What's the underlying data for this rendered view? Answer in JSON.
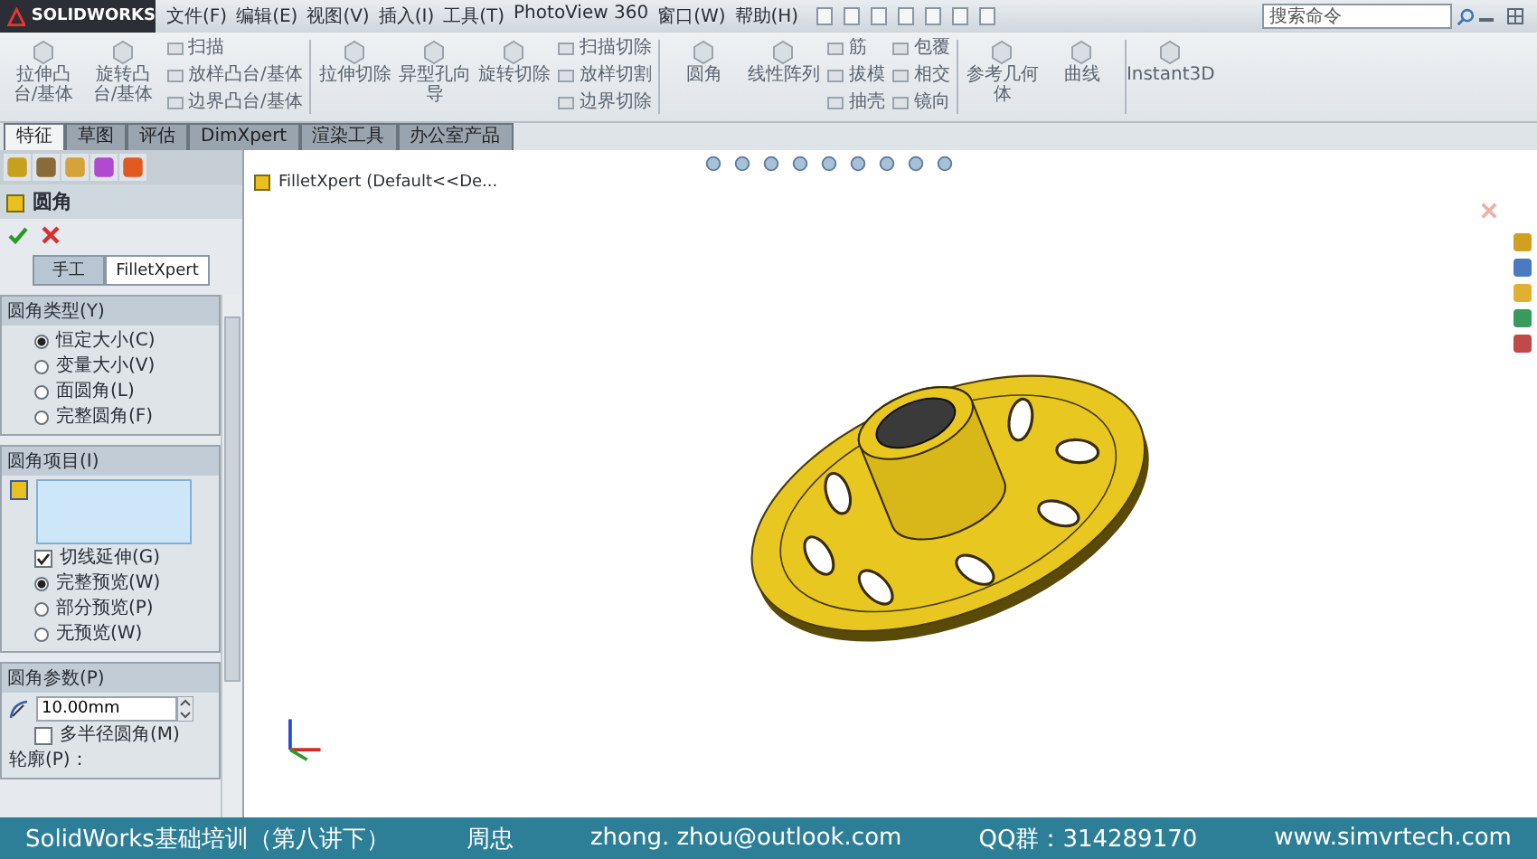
{
  "app": {
    "logo": "SOLIDWORKS"
  },
  "menu": [
    "文件(F)",
    "编辑(E)",
    "视图(V)",
    "插入(I)",
    "工具(T)",
    "PhotoView 360",
    "窗口(W)",
    "帮助(H)"
  ],
  "search": {
    "placeholder": "搜索命令"
  },
  "ribbon": [
    {
      "items": [
        {
          "kind": "large",
          "label": "拉伸凸台/基体"
        },
        {
          "kind": "large",
          "label": "旋转凸台/基体"
        },
        {
          "kind": "stack",
          "labels": [
            "扫描",
            "放样凸台/基体",
            "边界凸台/基体"
          ]
        }
      ]
    },
    {
      "items": [
        {
          "kind": "large",
          "label": "拉伸切除"
        },
        {
          "kind": "large",
          "label": "异型孔向导"
        },
        {
          "kind": "large",
          "label": "旋转切除"
        },
        {
          "kind": "stack",
          "labels": [
            "扫描切除",
            "放样切割",
            "边界切除"
          ]
        }
      ]
    },
    {
      "items": [
        {
          "kind": "large",
          "label": "圆角"
        },
        {
          "kind": "large",
          "label": "线性阵列"
        },
        {
          "kind": "stack",
          "labels": [
            "筋",
            "拔模",
            "抽壳"
          ]
        },
        {
          "kind": "stack",
          "labels": [
            "包覆",
            "相交",
            "镜向"
          ]
        }
      ]
    },
    {
      "items": [
        {
          "kind": "large",
          "label": "参考几何体"
        },
        {
          "kind": "large",
          "label": "曲线"
        }
      ]
    },
    {
      "items": [
        {
          "kind": "large",
          "label": "Instant3D"
        }
      ]
    }
  ],
  "tabs": [
    {
      "label": "特征",
      "selected": true
    },
    {
      "label": "草图",
      "selected": false
    },
    {
      "label": "评估",
      "selected": false
    },
    {
      "label": "DimXpert",
      "selected": false
    },
    {
      "label": "渲染工具",
      "selected": false
    },
    {
      "label": "办公室产品",
      "selected": false
    }
  ],
  "panel": {
    "title": "圆角",
    "modes": [
      {
        "label": "手工",
        "selected": true
      },
      {
        "label": "FilletXpert",
        "selected": false
      }
    ],
    "groups": [
      {
        "title": "圆角类型(Y)",
        "rows": [
          {
            "kind": "radio",
            "label": "恒定大小(C)",
            "selected": true
          },
          {
            "kind": "radio",
            "label": "变量大小(V)",
            "selected": false
          },
          {
            "kind": "radio",
            "label": "面圆角(L)",
            "selected": false
          },
          {
            "kind": "radio",
            "label": "完整圆角(F)",
            "selected": false
          }
        ]
      },
      {
        "title": "圆角项目(I)",
        "rows": [
          {
            "kind": "selection_box"
          },
          {
            "kind": "checkbox",
            "label": "切线延伸(G)",
            "checked": true
          },
          {
            "kind": "radio",
            "label": "完整预览(W)",
            "selected": true
          },
          {
            "kind": "radio",
            "label": "部分预览(P)",
            "selected": false
          },
          {
            "kind": "radio",
            "label": "无预览(W)",
            "selected": false
          }
        ]
      },
      {
        "title": "圆角参数(P)",
        "rows": [
          {
            "kind": "number_field",
            "value": "10.00mm"
          },
          {
            "kind": "checkbox",
            "label": "多半径圆角(M)",
            "checked": false
          },
          {
            "kind": "label",
            "label": "轮廓(P)："
          }
        ]
      }
    ]
  },
  "tree": {
    "label": "FilletXpert  (Default<<De..."
  },
  "footer": [
    "SolidWorks基础培训（第八讲下）",
    "周忠",
    "zhong. zhou@outlook.com",
    "QQ群：314289170",
    "www.simvrtech.com"
  ]
}
